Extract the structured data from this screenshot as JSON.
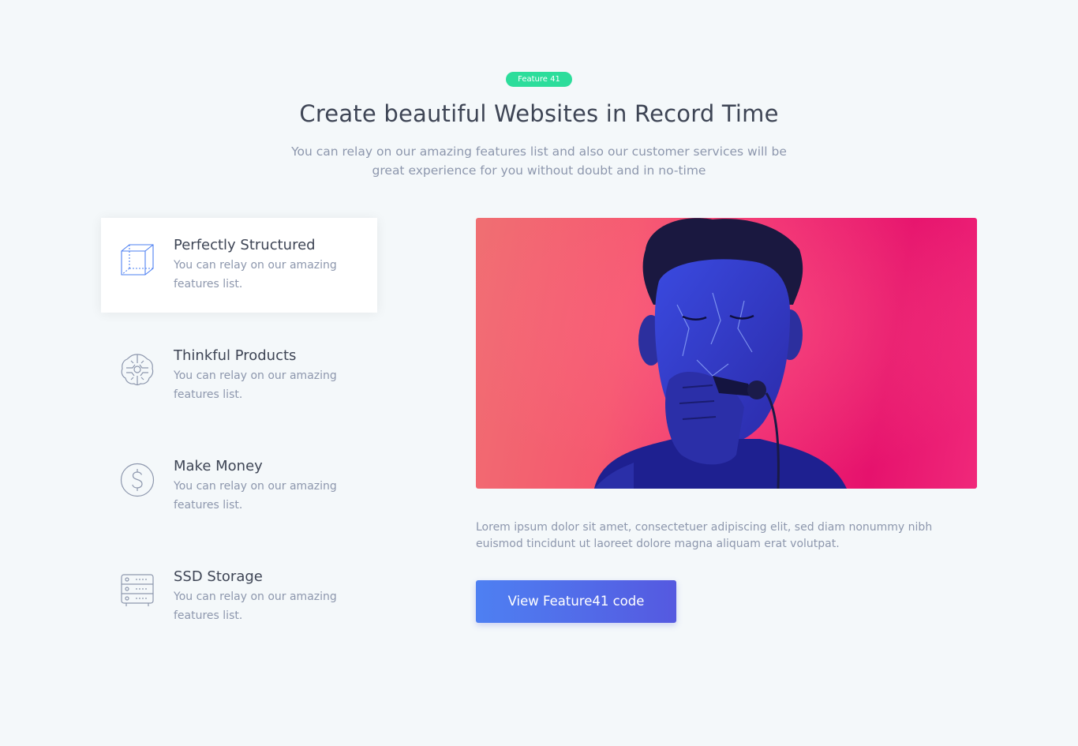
{
  "badge": "Feature 41",
  "header": {
    "title": "Create beautiful Websites in Record Time",
    "subtitle": "You can relay on our amazing features list and also our customer services will be great experience for you without doubt and in no-time"
  },
  "features": [
    {
      "title": "Perfectly Structured",
      "text": "You can relay on our amazing features list.",
      "icon": "cube-icon",
      "active": true
    },
    {
      "title": "Thinkful Products",
      "text": "You can relay on our amazing features list.",
      "icon": "brain-circuit-icon",
      "active": false
    },
    {
      "title": "Make Money",
      "text": "You can relay on our amazing features list.",
      "icon": "dollar-coin-icon",
      "active": false
    },
    {
      "title": "SSD Storage",
      "text": "You can relay on our amazing features list.",
      "icon": "server-icon",
      "active": false
    }
  ],
  "main": {
    "photo_subject": "singer-with-microphone-photo",
    "description": "Lorem ipsum dolor sit amet, consectetuer adipiscing elit, sed diam nonummy nibh euismod tincidunt ut laoreet dolore magna aliquam erat volutpat.",
    "cta_label": "View Feature41 code"
  },
  "colors": {
    "badge": "#2cdd9b",
    "button_start": "#4e80f2",
    "button_end": "#5559e0",
    "icon_active": "#4e80f2",
    "icon_muted": "#8d97ad",
    "background": "#f4f8fa"
  }
}
